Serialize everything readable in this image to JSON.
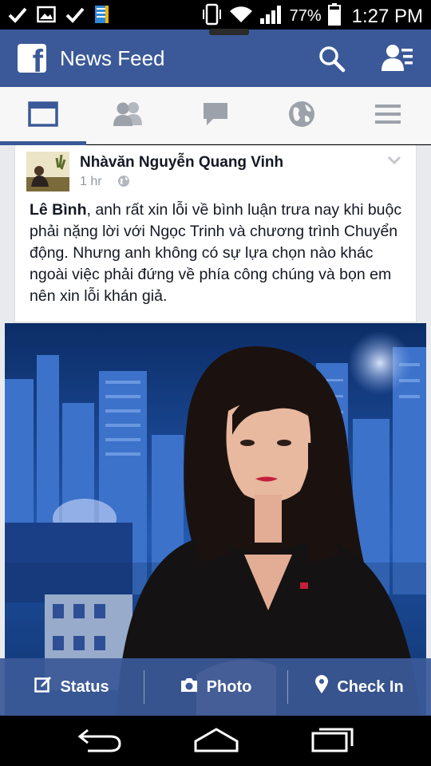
{
  "status_bar": {
    "battery_pct": "77%",
    "time": "1:27 PM",
    "icons": [
      "check-icon",
      "image-icon",
      "check-icon",
      "book-icon",
      "vibrate-icon",
      "wifi-icon",
      "signal-icon",
      "battery-icon"
    ]
  },
  "header": {
    "logo_letter": "f",
    "title": "News Feed",
    "icons": [
      "search-icon",
      "friend-requests-icon"
    ]
  },
  "tabs": [
    {
      "name": "news-feed",
      "icon": "news-feed-icon",
      "active": true
    },
    {
      "name": "friends",
      "icon": "friends-icon",
      "active": false
    },
    {
      "name": "messages",
      "icon": "messages-icon",
      "active": false
    },
    {
      "name": "notifications",
      "icon": "globe-icon",
      "active": false
    },
    {
      "name": "more",
      "icon": "menu-icon",
      "active": false
    }
  ],
  "post": {
    "author": "Nhàvăn Nguyễn Quang Vinh",
    "time": "1 hr",
    "privacy_icon": "globe-icon",
    "mention": "Lê Bình",
    "text": ", anh rất xin lỗi về bình luận trưa nay khi buộc phải nặng lời với Ngọc Trinh và chương trình Chuyển động. Nhưng anh không có sự lựa chọn nào khác ngoài việc phải đứng về phía công chúng và bọn em nên xin lỗi khán giả.",
    "image_description_icon": "news-anchor-photo"
  },
  "actions": [
    {
      "label": "Status",
      "icon": "edit-icon"
    },
    {
      "label": "Photo",
      "icon": "camera-icon"
    },
    {
      "label": "Check In",
      "icon": "location-pin-icon"
    }
  ],
  "nav": {
    "icons": [
      "back-icon",
      "home-icon",
      "recent-apps-icon"
    ]
  },
  "colors": {
    "brand": "#3b5998",
    "feed_bg": "#e9eaed",
    "text": "#141823",
    "meta": "#9197a3"
  }
}
